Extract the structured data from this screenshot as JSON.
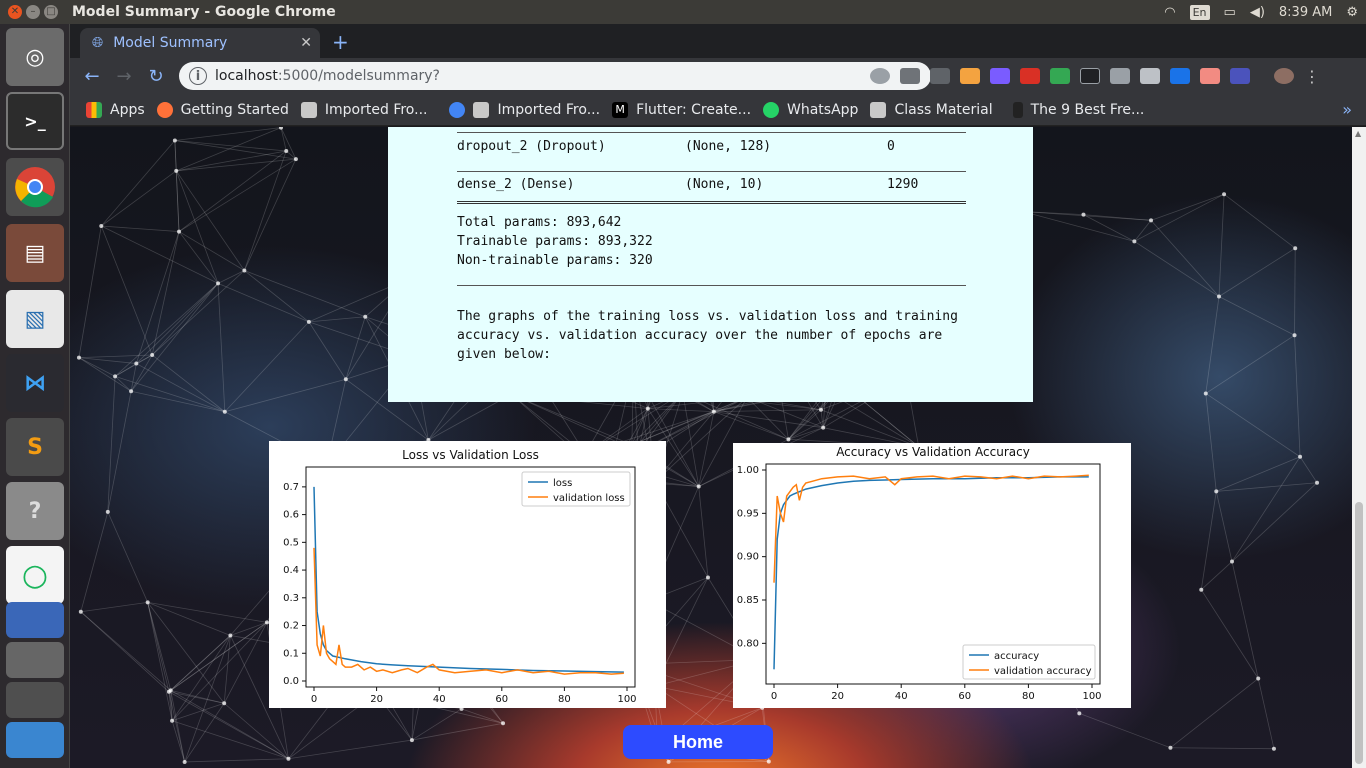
{
  "os": {
    "window_title": "Model Summary - Google Chrome",
    "lang": "En",
    "clock": "8:39 AM"
  },
  "browser": {
    "tab_title": "Model Summary",
    "url_host": "localhost",
    "url_path": ":5000/modelsummary?",
    "bookmarks": [
      "Apps",
      "Getting Started",
      "Imported Fro...",
      "Imported Fro...",
      "Flutter: Create...",
      "WhatsApp",
      "Class Material",
      "The 9 Best Fre..."
    ]
  },
  "summary": {
    "rows": [
      {
        "layer": "dropout_2 (Dropout)",
        "shape": "(None, 128)",
        "params": "0"
      },
      {
        "layer": "dense_2 (Dense)",
        "shape": "(None, 10)",
        "params": "1290"
      }
    ],
    "total": "Total params: 893,642",
    "trainable": "Trainable params: 893,322",
    "non_trainable": "Non-trainable params: 320",
    "paragraph": "The graphs of the training loss vs. validation loss and training accuracy vs. validation accuracy over the number of epochs are given below:"
  },
  "home_label": "Home",
  "colors": {
    "blue": "#1f77b4",
    "orange": "#ff7f0e",
    "panel": "#e6ffff",
    "home": "#2d4bff"
  },
  "chart_data": [
    {
      "type": "line",
      "title": "Loss vs Validation Loss",
      "xlim": [
        0,
        100
      ],
      "ylim": [
        0,
        0.75
      ],
      "xticks": [
        0,
        20,
        40,
        60,
        80,
        100
      ],
      "yticks": [
        0.0,
        0.1,
        0.2,
        0.3,
        0.4,
        0.5,
        0.6,
        0.7
      ],
      "legend": "top-right",
      "series": [
        {
          "name": "loss",
          "x": [
            0,
            1,
            2,
            3,
            4,
            5,
            6,
            8,
            10,
            15,
            20,
            25,
            30,
            40,
            50,
            60,
            70,
            80,
            90,
            99
          ],
          "y": [
            0.7,
            0.25,
            0.17,
            0.13,
            0.11,
            0.1,
            0.09,
            0.085,
            0.08,
            0.07,
            0.062,
            0.058,
            0.055,
            0.05,
            0.045,
            0.042,
            0.038,
            0.036,
            0.034,
            0.032
          ]
        },
        {
          "name": "validation loss",
          "x": [
            0,
            1,
            2,
            3,
            4,
            5,
            6,
            7,
            8,
            9,
            10,
            12,
            14,
            16,
            18,
            20,
            22,
            25,
            28,
            30,
            33,
            36,
            38,
            40,
            45,
            50,
            55,
            60,
            65,
            70,
            75,
            80,
            85,
            90,
            95,
            99
          ],
          "y": [
            0.48,
            0.13,
            0.09,
            0.2,
            0.1,
            0.08,
            0.07,
            0.06,
            0.13,
            0.06,
            0.05,
            0.05,
            0.06,
            0.04,
            0.05,
            0.035,
            0.04,
            0.03,
            0.04,
            0.045,
            0.03,
            0.05,
            0.06,
            0.04,
            0.03,
            0.035,
            0.04,
            0.03,
            0.04,
            0.03,
            0.035,
            0.025,
            0.03,
            0.03,
            0.025,
            0.028
          ]
        }
      ]
    },
    {
      "type": "line",
      "title": "Accuracy vs Validation Accuracy",
      "xlim": [
        0,
        100
      ],
      "ylim": [
        0.76,
        1.0
      ],
      "xticks": [
        0,
        20,
        40,
        60,
        80,
        100
      ],
      "yticks": [
        0.8,
        0.85,
        0.9,
        0.95,
        1.0
      ],
      "legend": "bottom-right",
      "series": [
        {
          "name": "accuracy",
          "x": [
            0,
            1,
            2,
            3,
            4,
            5,
            6,
            8,
            10,
            15,
            20,
            25,
            30,
            40,
            50,
            60,
            70,
            80,
            90,
            99
          ],
          "y": [
            0.77,
            0.92,
            0.95,
            0.96,
            0.965,
            0.97,
            0.972,
            0.975,
            0.978,
            0.982,
            0.985,
            0.987,
            0.988,
            0.989,
            0.99,
            0.99,
            0.991,
            0.991,
            0.992,
            0.992
          ]
        },
        {
          "name": "validation accuracy",
          "x": [
            0,
            1,
            2,
            3,
            4,
            5,
            6,
            7,
            8,
            9,
            10,
            12,
            15,
            20,
            25,
            30,
            35,
            38,
            40,
            45,
            50,
            55,
            60,
            65,
            70,
            75,
            80,
            85,
            90,
            95,
            99
          ],
          "y": [
            0.87,
            0.97,
            0.95,
            0.94,
            0.97,
            0.975,
            0.98,
            0.983,
            0.965,
            0.98,
            0.985,
            0.987,
            0.99,
            0.992,
            0.993,
            0.99,
            0.992,
            0.983,
            0.99,
            0.992,
            0.993,
            0.99,
            0.993,
            0.992,
            0.99,
            0.993,
            0.99,
            0.993,
            0.992,
            0.993,
            0.994
          ]
        }
      ]
    }
  ]
}
